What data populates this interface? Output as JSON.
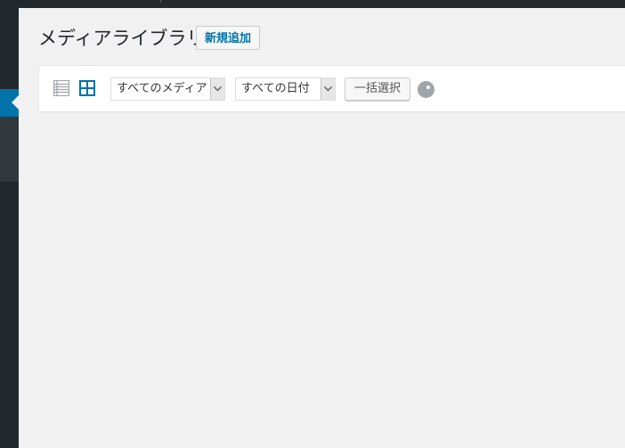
{
  "page": {
    "title": "メディアライブラリ",
    "add_new_label": "新規追加"
  },
  "toolbar": {
    "media_filter": "すべてのメディア",
    "date_filter": "すべての日付",
    "bulk_select_label": "一括選択",
    "active_view": "grid"
  },
  "colors": {
    "accent": "#0073aa",
    "sidebar": "#23282d",
    "background": "#f1f1f1"
  }
}
